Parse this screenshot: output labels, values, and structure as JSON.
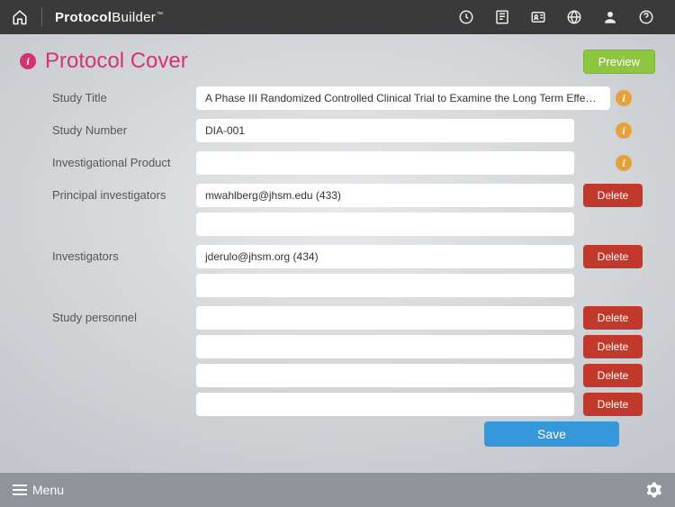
{
  "app": {
    "logo_bold": "Protocol",
    "logo_light": "Builder"
  },
  "page": {
    "title": "Protocol Cover",
    "preview": "Preview",
    "save": "Save"
  },
  "labels": {
    "studyTitle": "Study Title",
    "studyNumber": "Study Number",
    "product": "Investigational Product",
    "pi": "Principal investigators",
    "inv": "Investigators",
    "personnel": "Study personnel",
    "delete": "Delete"
  },
  "values": {
    "studyTitle": "A Phase III Randomized Controlled Clinical Trial to Examine the Long Term Effects of a...",
    "studyNumber": "DIA-001",
    "product": "",
    "piRows": [
      "mwahlberg@jhsm.edu (433)",
      ""
    ],
    "invRows": [
      "jderulo@jhsm.org (434)",
      ""
    ],
    "personnelRows": [
      "",
      "",
      "",
      ""
    ]
  },
  "footer": {
    "menu": "Menu"
  }
}
